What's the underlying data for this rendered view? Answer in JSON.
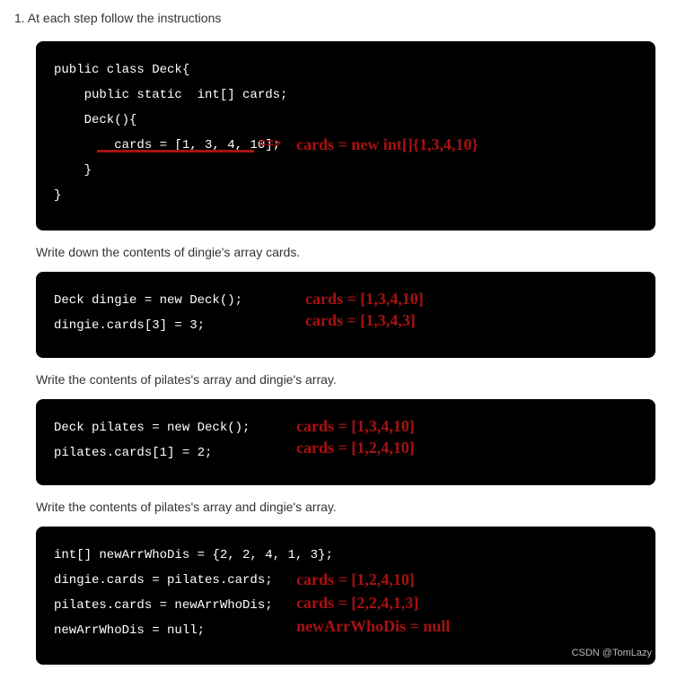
{
  "title": "1. At each step follow the instructions",
  "block1": {
    "code": "public class Deck{\n    public static  int[] cards;\n    Deck(){\n        cards = [1, 3, 4, 10];\n    }\n}",
    "anno_arrow": "==>",
    "anno_fix": "cards = new int[]{1,3,4,10}"
  },
  "instr1": "Write down the contents of dingie's array cards.",
  "block2": {
    "code": "Deck dingie = new Deck();\ndingie.cards[3] = 3;",
    "anno1": "cards = [1,3,4,10]",
    "anno2": "cards = [1,3,4,3]"
  },
  "instr2": "Write the contents of pilates's array and dingie's array.",
  "block3": {
    "code": "Deck pilates = new Deck();\npilates.cards[1] = 2;",
    "anno1": "cards = [1,3,4,10]",
    "anno2": "cards = [1,2,4,10]"
  },
  "instr3": "Write the contents of pilates's array and dingie's array.",
  "block4": {
    "code": "int[] newArrWhoDis = {2, 2, 4, 1, 3};\ndingie.cards = pilates.cards;\npilates.cards = newArrWhoDis;\nnewArrWhoDis = null;",
    "anno1": "cards = [1,2,4,10]",
    "anno2": "cards = [2,2,4,1,3]",
    "anno3": "newArrWhoDis = null",
    "watermark": "CSDN @TomLazy"
  }
}
